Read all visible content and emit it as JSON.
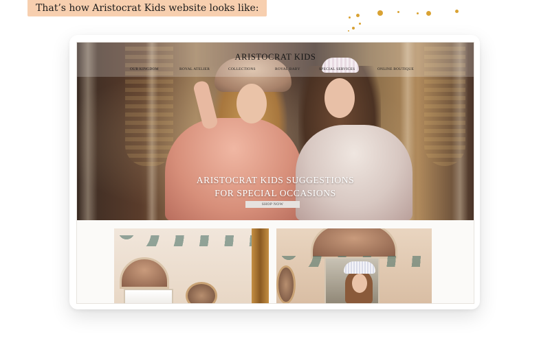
{
  "caption": "That’s how Aristocrat Kids website looks like:",
  "site": {
    "logo": "ARISTOCRAT KIDS",
    "nav": [
      "OUR KINGDOM",
      "ROYAL ATELIER",
      "COLLECTIONS",
      "ROYAL BABY",
      "SPECIAL SERVICES",
      "ONLINE BOUTIQUE"
    ],
    "hero": {
      "line1": "ARISTOCRAT KIDS SUGGESTIONS",
      "line2": "FOR SPECIAL OCCASIONS",
      "cta": "SHOP NOW"
    }
  },
  "colors": {
    "caption_bg": "#f7cfaf",
    "accent_gold": "#d9a233"
  }
}
